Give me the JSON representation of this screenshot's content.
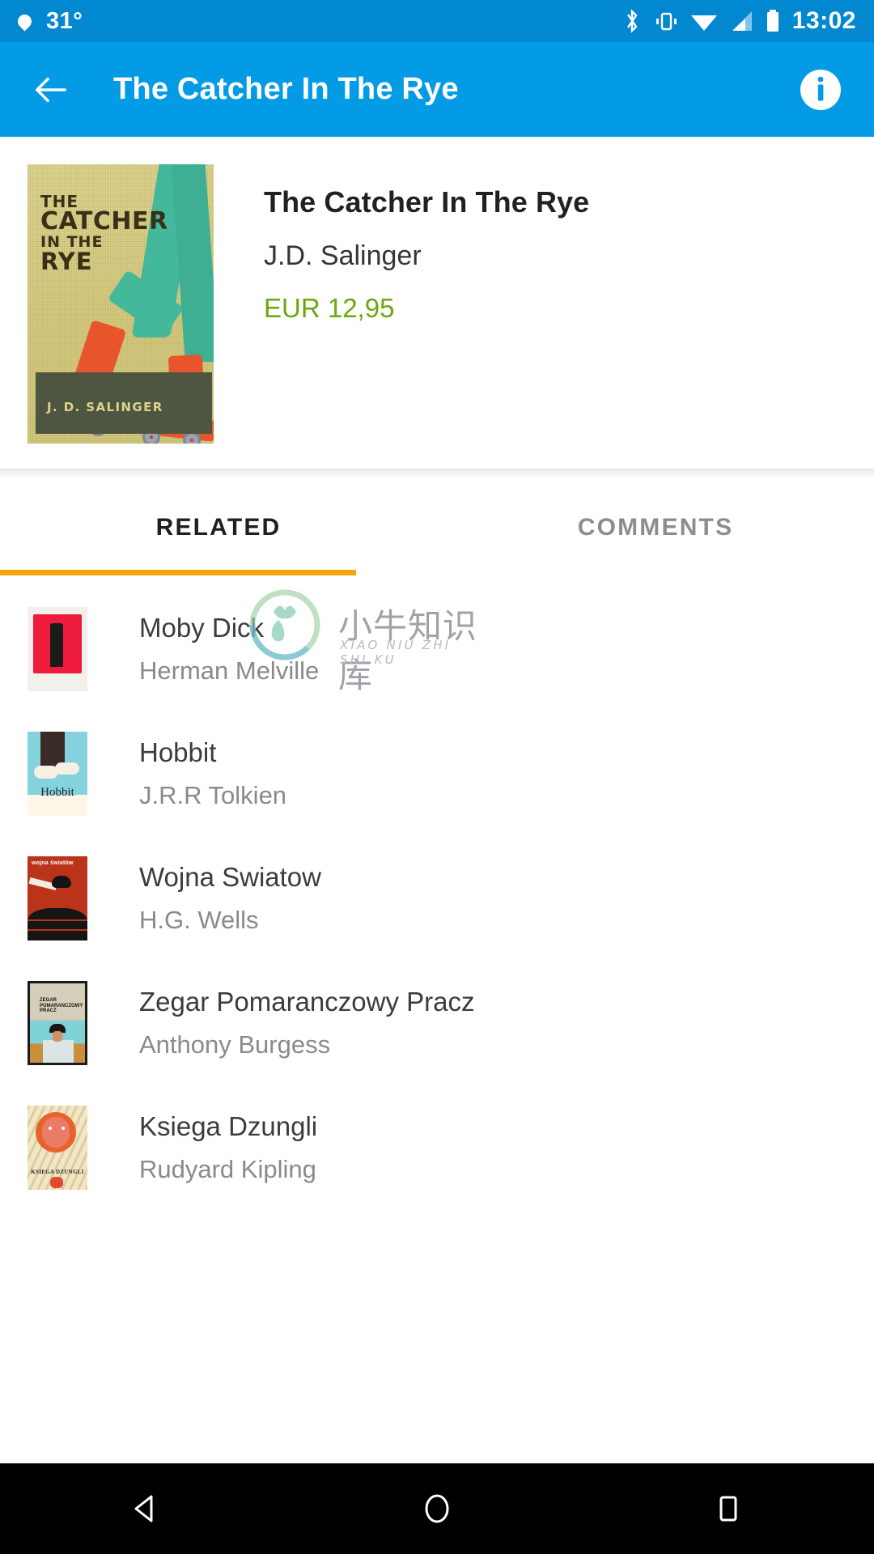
{
  "status_bar": {
    "weather_icon": "droplet-icon",
    "temperature": "31°",
    "icons": [
      "bluetooth-icon",
      "vibrate-icon",
      "wifi-icon",
      "cellular-signal-icon",
      "battery-icon"
    ],
    "time": "13:02",
    "background_color": "#0288d1"
  },
  "app_bar": {
    "back_icon": "back-arrow-icon",
    "title": "The Catcher In The Rye",
    "info_icon": "info-icon",
    "background_color": "#039be5"
  },
  "book": {
    "cover": {
      "line1": "THE",
      "line2": "CATCHER",
      "line3": "IN THE",
      "line4": "RYE",
      "author_band": "J. D. SALINGER"
    },
    "title": "The Catcher In The Rye",
    "author": "J.D. Salinger",
    "price": "EUR 12,95",
    "price_color": "#6aa80c"
  },
  "tabs": {
    "items": [
      {
        "label": "RELATED",
        "active": true
      },
      {
        "label": "COMMENTS",
        "active": false
      }
    ],
    "indicator_color": "#f5a608"
  },
  "related": {
    "items": [
      {
        "title": "Moby Dick",
        "author": "Herman Melville",
        "cover": "moby-dick-cover"
      },
      {
        "title": "Hobbit",
        "author": "J.R.R Tolkien",
        "cover": "hobbit-cover",
        "cover_label": "Hobbit"
      },
      {
        "title": "Wojna Swiatow",
        "author": "H.G. Wells",
        "cover": "wojna-swiatow-cover",
        "cover_label": "wojna światów"
      },
      {
        "title": "Zegar Pomaranczowy Pracz",
        "author": "Anthony Burgess",
        "cover": "zegar-pomaranczowy-cover",
        "cover_label": "ZEGAR POMARANCZOWY PRACZ"
      },
      {
        "title": "Ksiega Dzungli",
        "author": "Rudyard Kipling",
        "cover": "ksiega-dzungli-cover",
        "cover_label": "KSIEGA DZUNGLI"
      }
    ]
  },
  "watermark": {
    "chinese": "小牛知识库",
    "pinyin": "XIAO NIU ZHI SHI KU"
  },
  "nav_bar": {
    "back": "nav-back-icon",
    "home": "nav-home-icon",
    "recents": "nav-recents-icon"
  }
}
